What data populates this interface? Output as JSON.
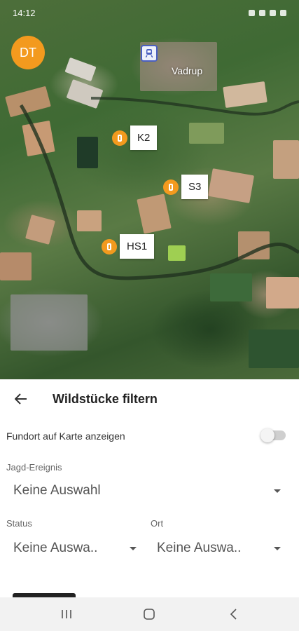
{
  "status_bar": {
    "time": "14:12"
  },
  "avatar": {
    "initials": "DT"
  },
  "map": {
    "town_label": "Vadrup",
    "markers": [
      {
        "label": "K2"
      },
      {
        "label": "S3"
      },
      {
        "label": "HS1"
      }
    ]
  },
  "panel": {
    "title": "Wildstücke filtern",
    "toggle": {
      "label": "Fundort auf Karte anzeigen",
      "on": false
    },
    "event": {
      "label": "Jagd-Ereignis",
      "value": "Keine Auswahl"
    },
    "status": {
      "label": "Status",
      "value": "Keine Auswa.."
    },
    "location": {
      "label": "Ort",
      "value": "Keine Auswa.."
    }
  },
  "colors": {
    "accent": "#f39a1e",
    "text": "#222222",
    "label": "#666666"
  }
}
